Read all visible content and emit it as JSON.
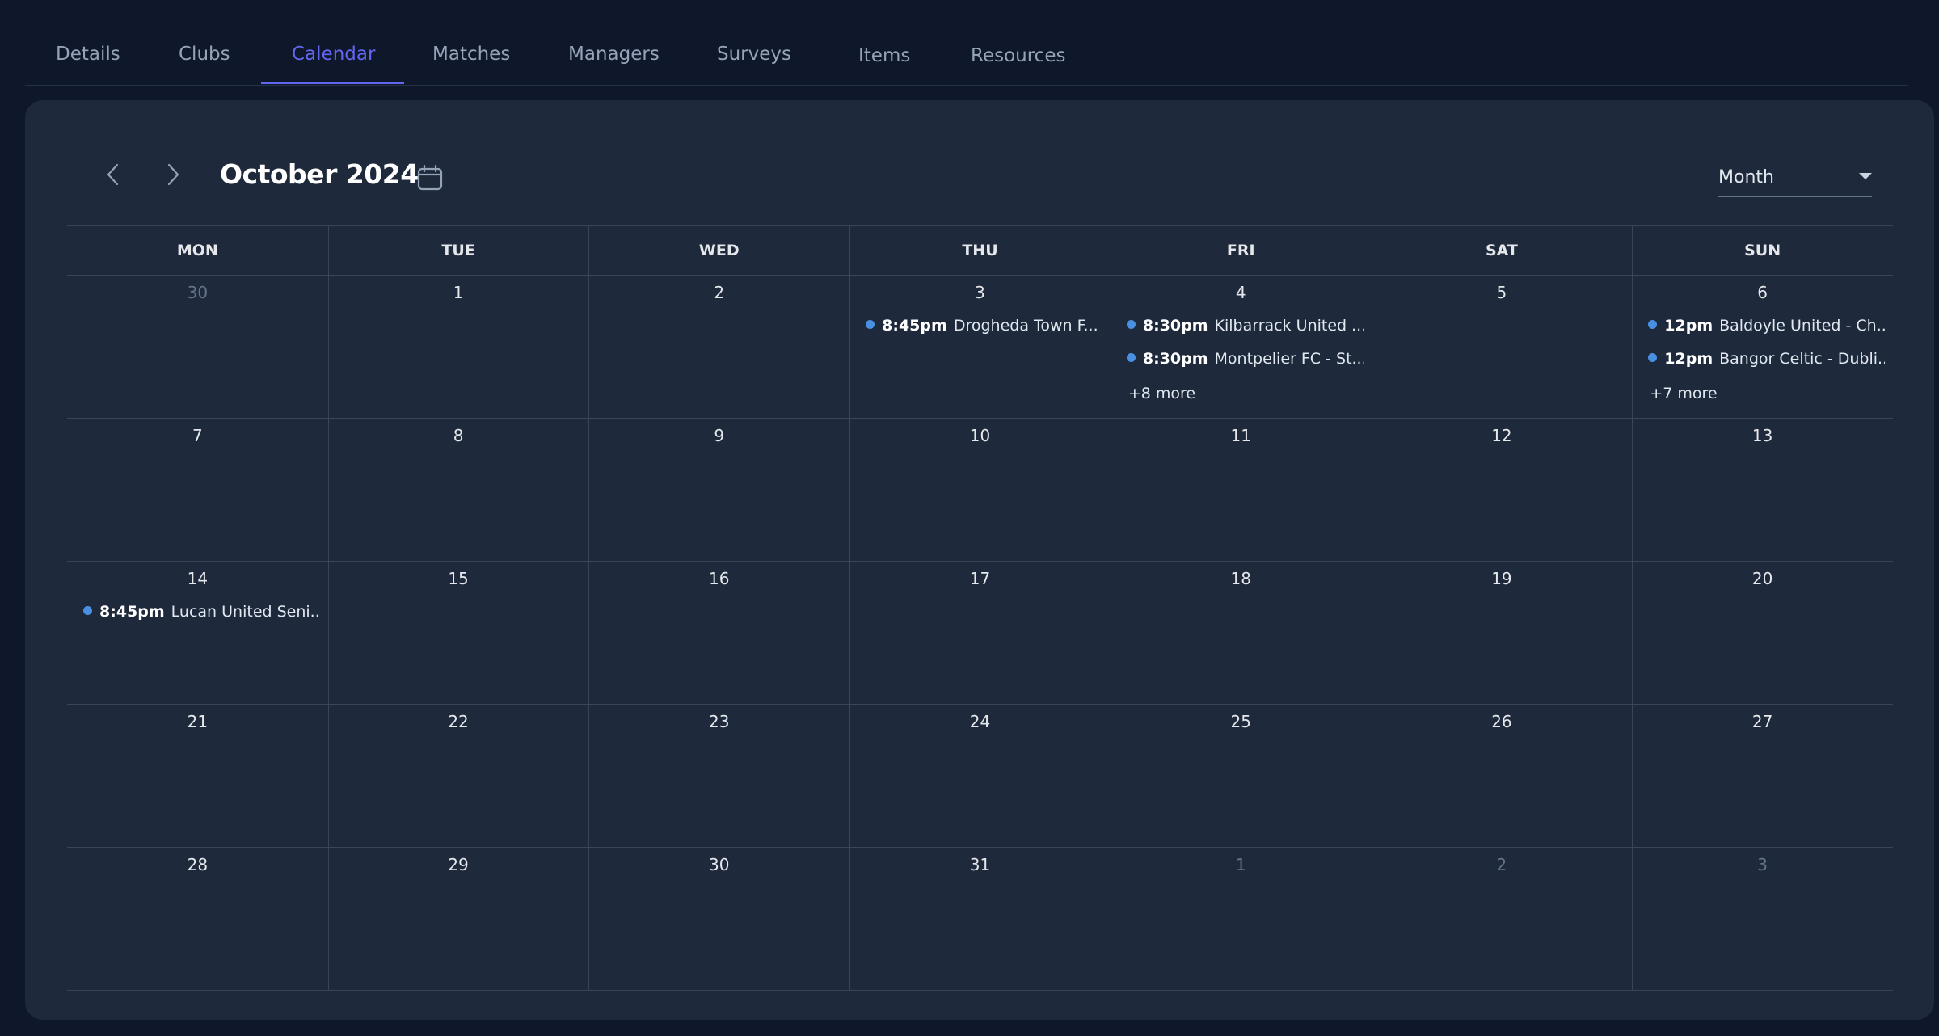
{
  "tabs": [
    {
      "label": "Details"
    },
    {
      "label": "Clubs"
    },
    {
      "label": "Calendar"
    },
    {
      "label": "Matches"
    },
    {
      "label": "Managers"
    },
    {
      "label": "Surveys"
    },
    {
      "label": "Items"
    },
    {
      "label": "Resources"
    }
  ],
  "calendar": {
    "month_title": "October 2024",
    "view": "Month",
    "weekdays": [
      "MON",
      "TUE",
      "WED",
      "THU",
      "FRI",
      "SAT",
      "SUN"
    ],
    "weeks": [
      [
        {
          "day": "30",
          "muted": true,
          "events": [],
          "more": ""
        },
        {
          "day": "1",
          "events": [],
          "more": ""
        },
        {
          "day": "2",
          "events": [],
          "more": ""
        },
        {
          "day": "3",
          "events": [
            {
              "time": "8:45pm",
              "title": "Drogheda Town F..."
            }
          ],
          "more": ""
        },
        {
          "day": "4",
          "events": [
            {
              "time": "8:30pm",
              "title": "Kilbarrack United ..."
            },
            {
              "time": "8:30pm",
              "title": "Montpelier FC - St..."
            }
          ],
          "more": "+8 more"
        },
        {
          "day": "5",
          "events": [],
          "more": ""
        },
        {
          "day": "6",
          "events": [
            {
              "time": "12pm",
              "title": "Baldoyle United - Ch..."
            },
            {
              "time": "12pm",
              "title": "Bangor Celtic - Dubli..."
            }
          ],
          "more": "+7 more"
        }
      ],
      [
        {
          "day": "7",
          "events": [],
          "more": ""
        },
        {
          "day": "8",
          "events": [],
          "more": ""
        },
        {
          "day": "9",
          "events": [],
          "more": ""
        },
        {
          "day": "10",
          "events": [],
          "more": ""
        },
        {
          "day": "11",
          "events": [],
          "more": ""
        },
        {
          "day": "12",
          "events": [],
          "more": ""
        },
        {
          "day": "13",
          "events": [],
          "more": ""
        }
      ],
      [
        {
          "day": "14",
          "events": [
            {
              "time": "8:45pm",
              "title": "Lucan United Seni..."
            }
          ],
          "more": ""
        },
        {
          "day": "15",
          "events": [],
          "more": ""
        },
        {
          "day": "16",
          "events": [],
          "more": ""
        },
        {
          "day": "17",
          "events": [],
          "more": ""
        },
        {
          "day": "18",
          "events": [],
          "more": ""
        },
        {
          "day": "19",
          "events": [],
          "more": ""
        },
        {
          "day": "20",
          "events": [],
          "more": ""
        }
      ],
      [
        {
          "day": "21",
          "events": [],
          "more": ""
        },
        {
          "day": "22",
          "events": [],
          "more": ""
        },
        {
          "day": "23",
          "events": [],
          "more": ""
        },
        {
          "day": "24",
          "events": [],
          "more": ""
        },
        {
          "day": "25",
          "events": [],
          "more": ""
        },
        {
          "day": "26",
          "events": [],
          "more": ""
        },
        {
          "day": "27",
          "events": [],
          "more": ""
        }
      ],
      [
        {
          "day": "28",
          "events": [],
          "more": ""
        },
        {
          "day": "29",
          "events": [],
          "more": ""
        },
        {
          "day": "30",
          "events": [],
          "more": ""
        },
        {
          "day": "31",
          "events": [],
          "more": ""
        },
        {
          "day": "1",
          "muted": true,
          "events": [],
          "more": ""
        },
        {
          "day": "2",
          "muted": true,
          "events": [],
          "more": ""
        },
        {
          "day": "3",
          "muted": true,
          "events": [],
          "more": ""
        }
      ]
    ]
  },
  "colors": {
    "accent": "#6366f1",
    "event_dot": "#4a90e2",
    "background": "#0f172a",
    "panel": "#1e293b"
  },
  "icons": {
    "prev": "chevron-left-icon",
    "next": "chevron-right-icon",
    "date_picker": "calendar-icon",
    "dropdown": "caret-down-icon"
  }
}
